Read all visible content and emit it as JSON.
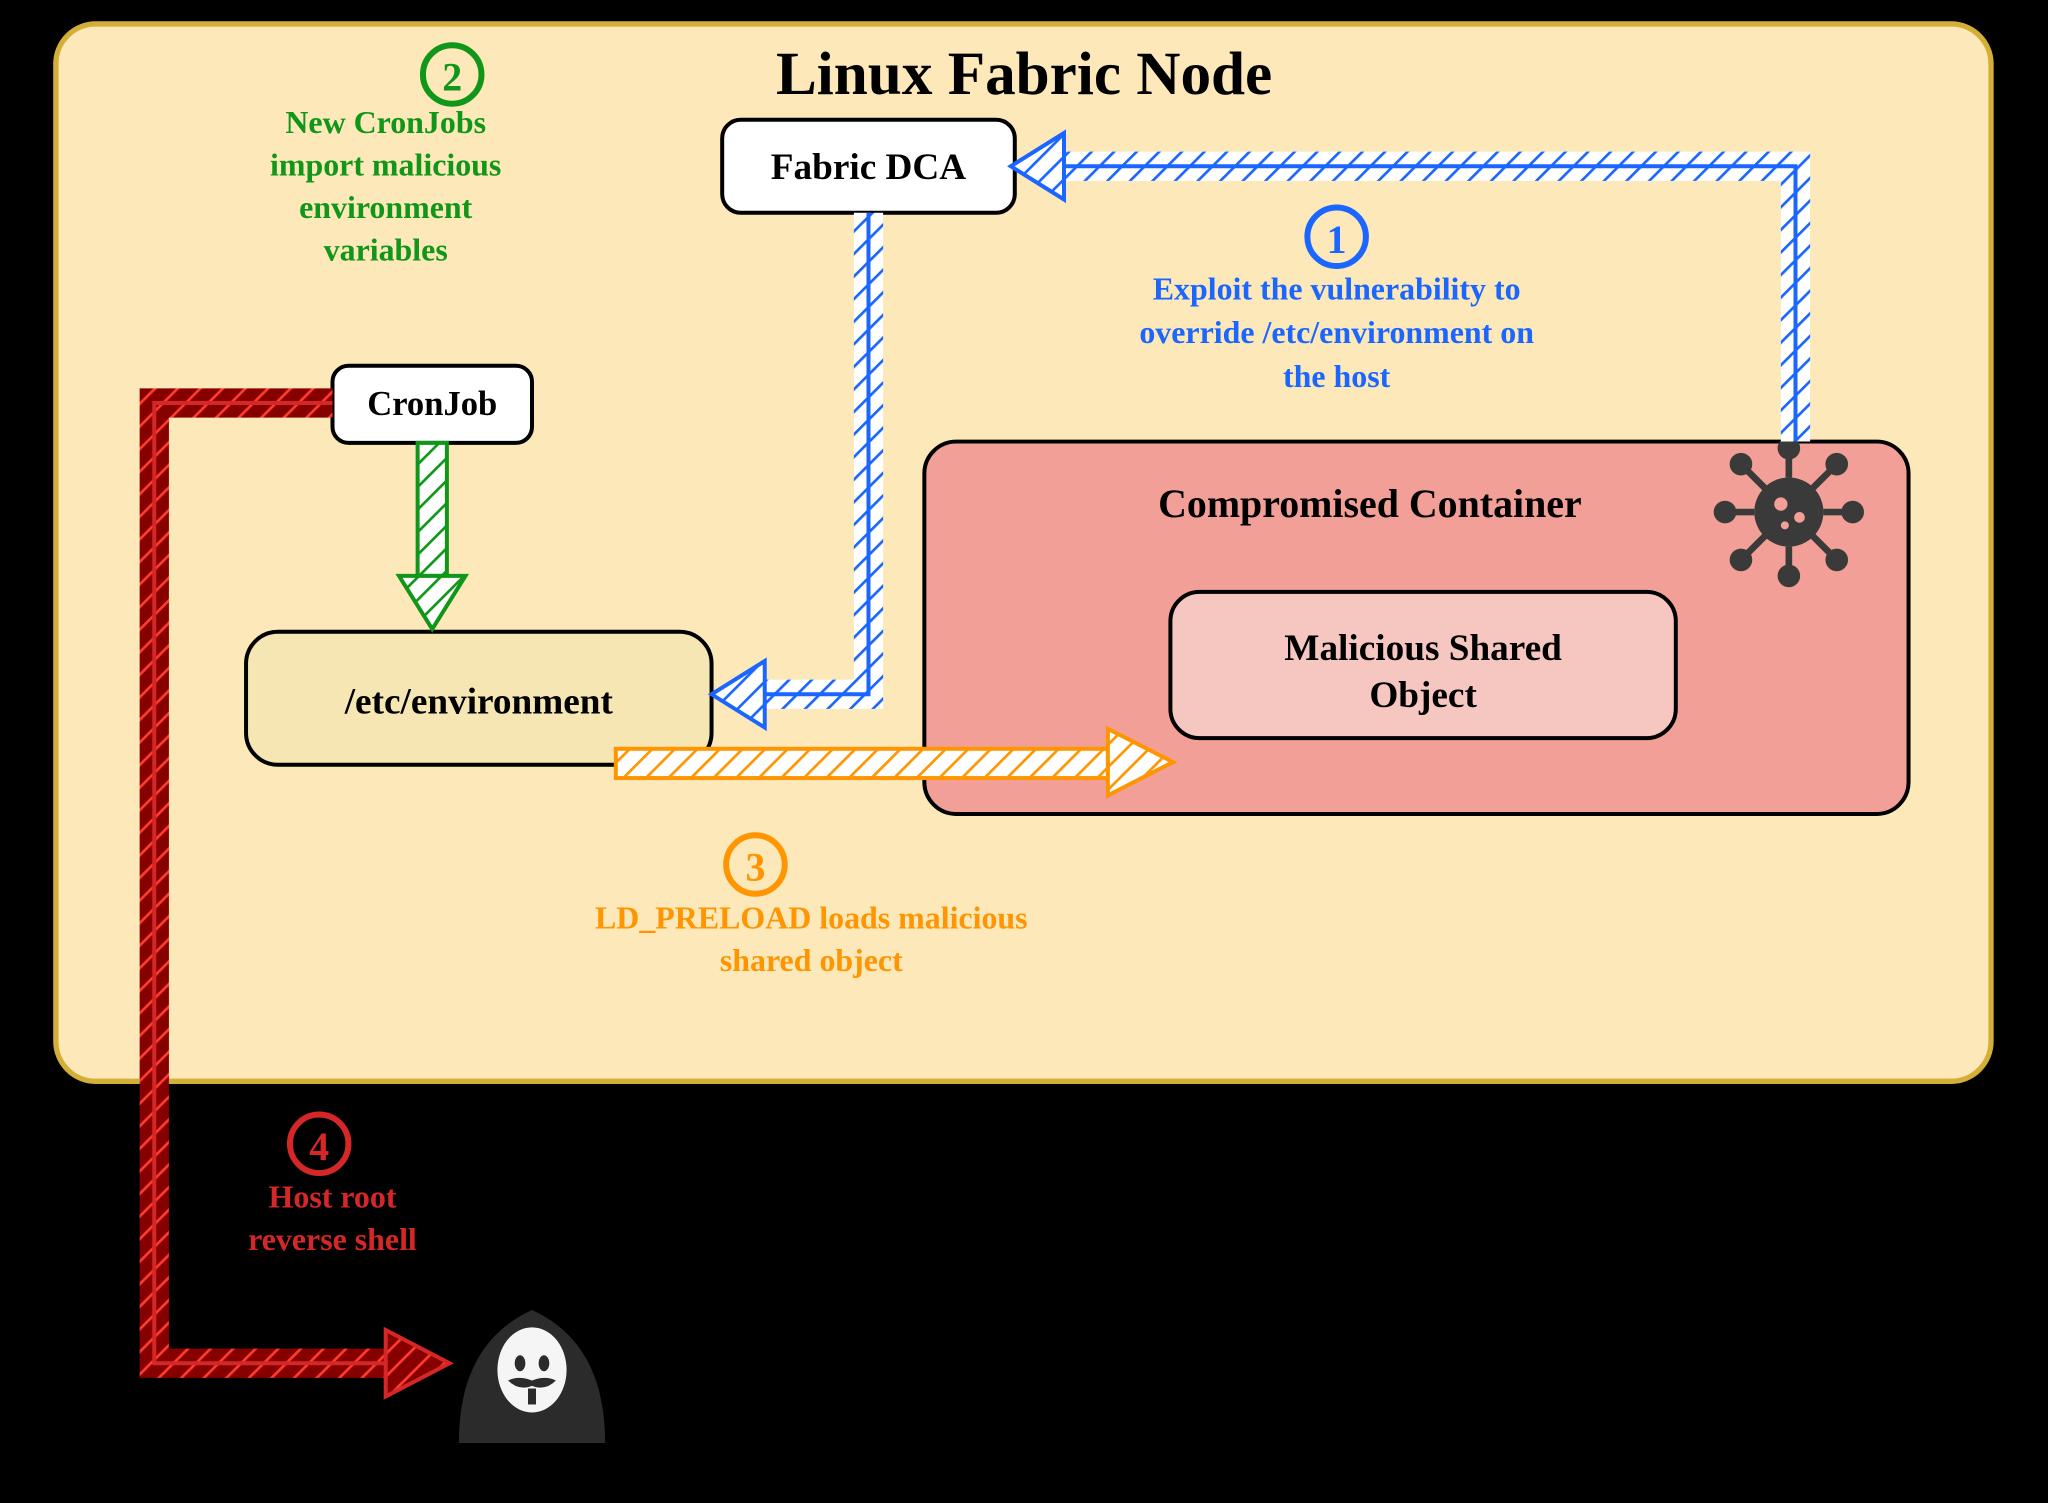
{
  "title": "Linux Fabric Node",
  "boxes": {
    "fabric_dca": "Fabric DCA",
    "cronjob": "CronJob",
    "etc_env": "/etc/environment",
    "container": "Compromised Container",
    "malicious_obj1": "Malicious Shared",
    "malicious_obj2": "Object"
  },
  "steps": {
    "s1": {
      "num": "1",
      "line1": "Exploit the vulnerability to",
      "line2": "override /etc/environment on",
      "line3": "the host",
      "color": "#1a66ff"
    },
    "s2": {
      "num": "2",
      "line1": "New CronJobs",
      "line2": "import malicious",
      "line3": "environment",
      "line4": "variables",
      "color": "#109618"
    },
    "s3": {
      "num": "3",
      "line1": "LD_PRELOAD loads malicious",
      "line2": "shared object",
      "color": "#ff9500"
    },
    "s4": {
      "num": "4",
      "line1": "Host root",
      "line2": "reverse shell",
      "color": "#d62728"
    }
  }
}
